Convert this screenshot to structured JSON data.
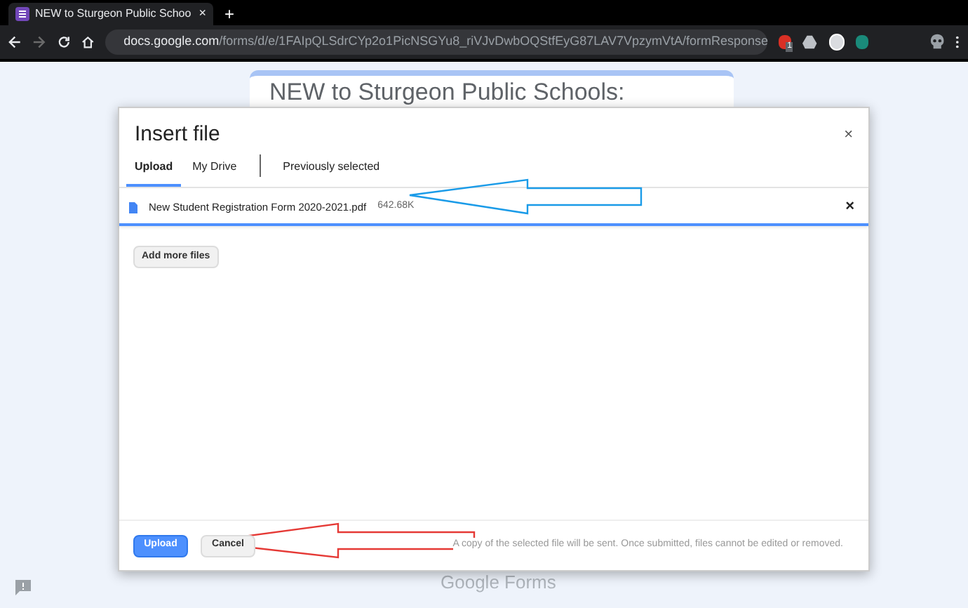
{
  "browser": {
    "tab_title": "NEW to Sturgeon Public Schoo",
    "tab_close": "×",
    "new_tab": "+",
    "url_host": "docs.google.com",
    "url_path": "/forms/d/e/1FAIpQLSdrCYp2o1PicNSGYu8_riVJvDwbOQStfEyG87LAV7VpzymVtA/formResponse",
    "extension_badge": "1"
  },
  "form": {
    "title": "NEW to Sturgeon Public Schools:",
    "footer": "Google Forms"
  },
  "dialog": {
    "title": "Insert file",
    "close": "×",
    "tabs": [
      {
        "label": "Upload",
        "selected": true
      },
      {
        "label": "My Drive",
        "selected": false
      },
      {
        "label": "Previously selected",
        "selected": false
      }
    ],
    "files": [
      {
        "name": "New Student Registration Form 2020-2021.pdf",
        "size": "642.68K",
        "remove": "×",
        "level": 1
      }
    ],
    "add_more": "Add more files",
    "buttons": [
      {
        "label": "Upload",
        "kind": "primary"
      },
      {
        "label": "Cancel",
        "kind": "secondary"
      }
    ],
    "note": "A copy of the selected file will be sent. Once submitted, files cannot be edited or removed."
  }
}
